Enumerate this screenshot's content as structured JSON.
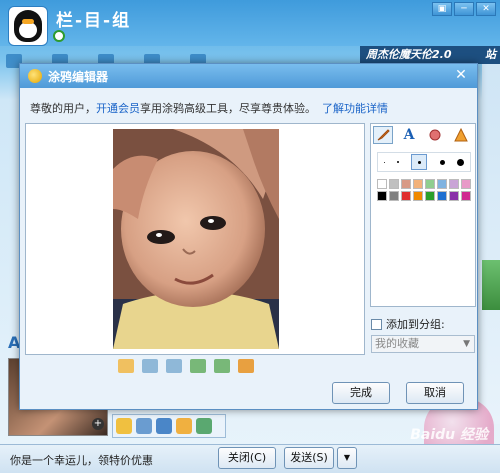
{
  "chat_window": {
    "contact_name": "栏-目-组",
    "ad_banner": "周杰伦魔天伦2.0",
    "ad_banner_extra": "站",
    "footer_text": "你是一个幸运儿，领特价优惠",
    "close_button": "关闭(C)",
    "send_button": "发送(S)",
    "send_dropdown": "▼",
    "window_controls": [
      "▣",
      "─",
      "✕"
    ],
    "watermark": "Baidu 经验",
    "letter_a": "A",
    "thumb_plus": "+"
  },
  "dialog": {
    "title": "涂鸦编辑器",
    "close": "✕",
    "notice_prefix": "尊敬的用户，",
    "notice_link": "开通会员",
    "notice_suffix": "享用涂鸦高级工具，尽享尊贵体验。",
    "notice_more": "了解功能详情",
    "add_to_group": "添加到分组:",
    "group_select_value": "我的收藏",
    "ok_button": "完成",
    "cancel_button": "取消",
    "tool_tab_text": "A",
    "palette_colors": [
      "#ffffff",
      "#c0c0c0",
      "#d89a86",
      "#f2b27a",
      "#8fce8f",
      "#7fb3e0",
      "#c9a3d6",
      "#e89ac8",
      "#000000",
      "#808080",
      "#e03030",
      "#f08a00",
      "#2aa02a",
      "#1e6fd0",
      "#8a2ea8",
      "#d02890"
    ]
  }
}
